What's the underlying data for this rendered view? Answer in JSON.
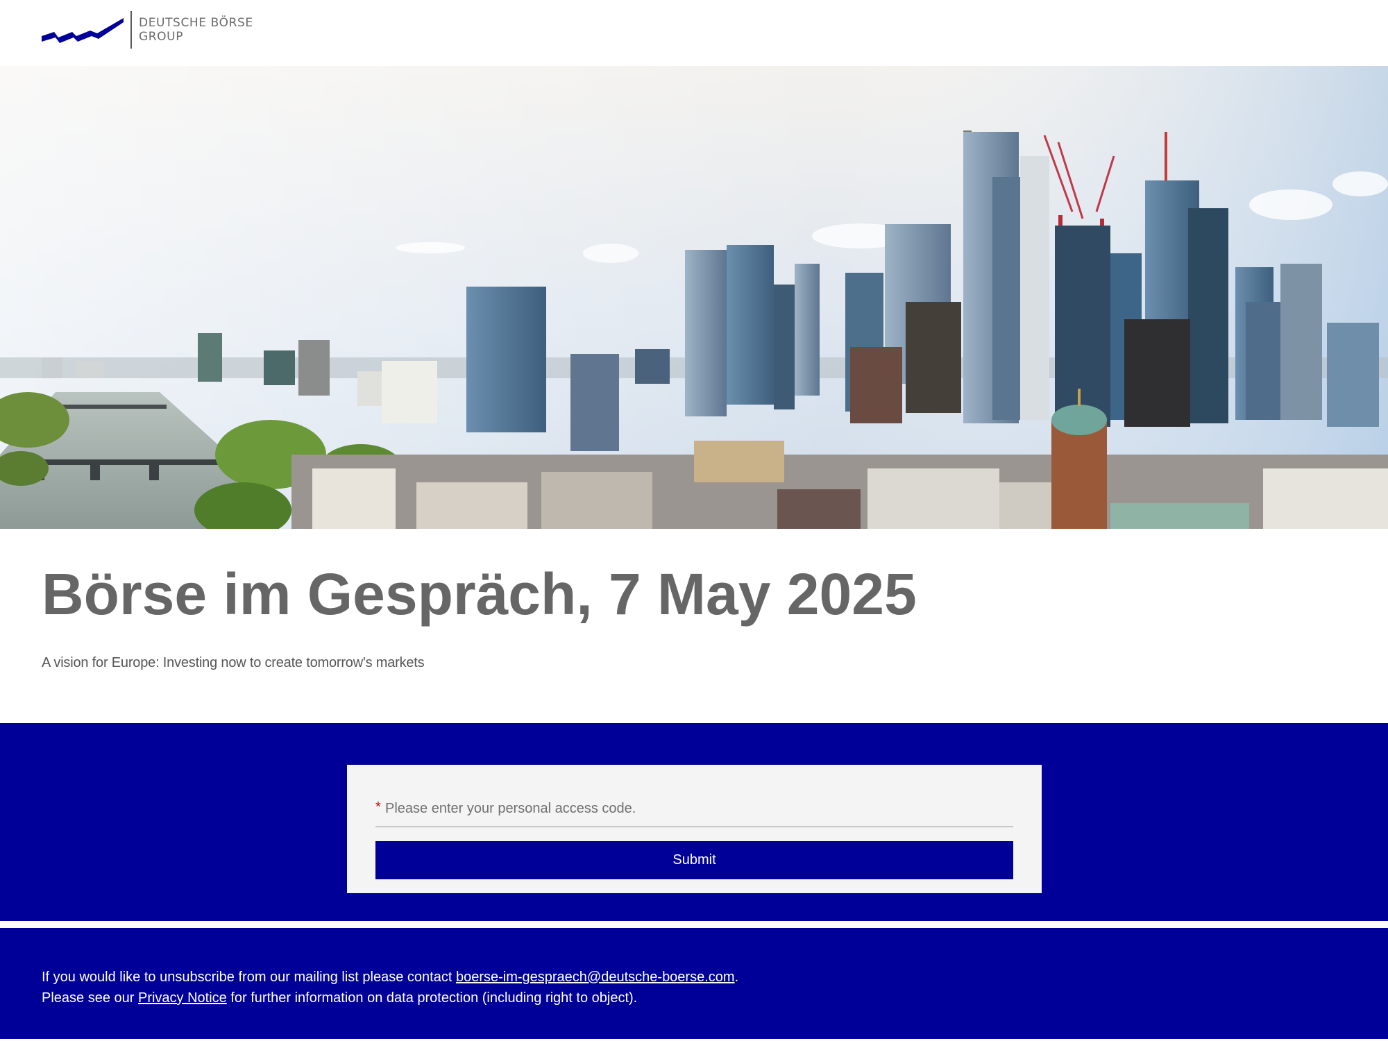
{
  "header": {
    "logo_line1": "DEUTSCHE BÖRSE",
    "logo_line2": "GROUP"
  },
  "hero": {
    "image": "frankfurt-skyline-photo"
  },
  "main": {
    "title": "Börse im Gespräch, 7 May 2025",
    "subtitle": "A vision for Europe: Investing now to create tomorrow's markets"
  },
  "form": {
    "required_marker": "*",
    "access_code_placeholder": "Please enter your personal access code.",
    "submit_label": "Submit"
  },
  "footer": {
    "line1_prefix": "If you would like to unsubscribe from our mailing list please contact ",
    "contact_email": "boerse-im-gespraech@deutsche-boerse.com",
    "line1_suffix": ".",
    "line2_prefix": "Please see our ",
    "privacy_link": "Privacy Notice",
    "line2_suffix": " for further information on data protection (including right to object)."
  },
  "colors": {
    "brand_blue": "#000099",
    "title_grey": "#666666",
    "card_bg": "#f4f4f4",
    "required_red": "#cc0000"
  }
}
